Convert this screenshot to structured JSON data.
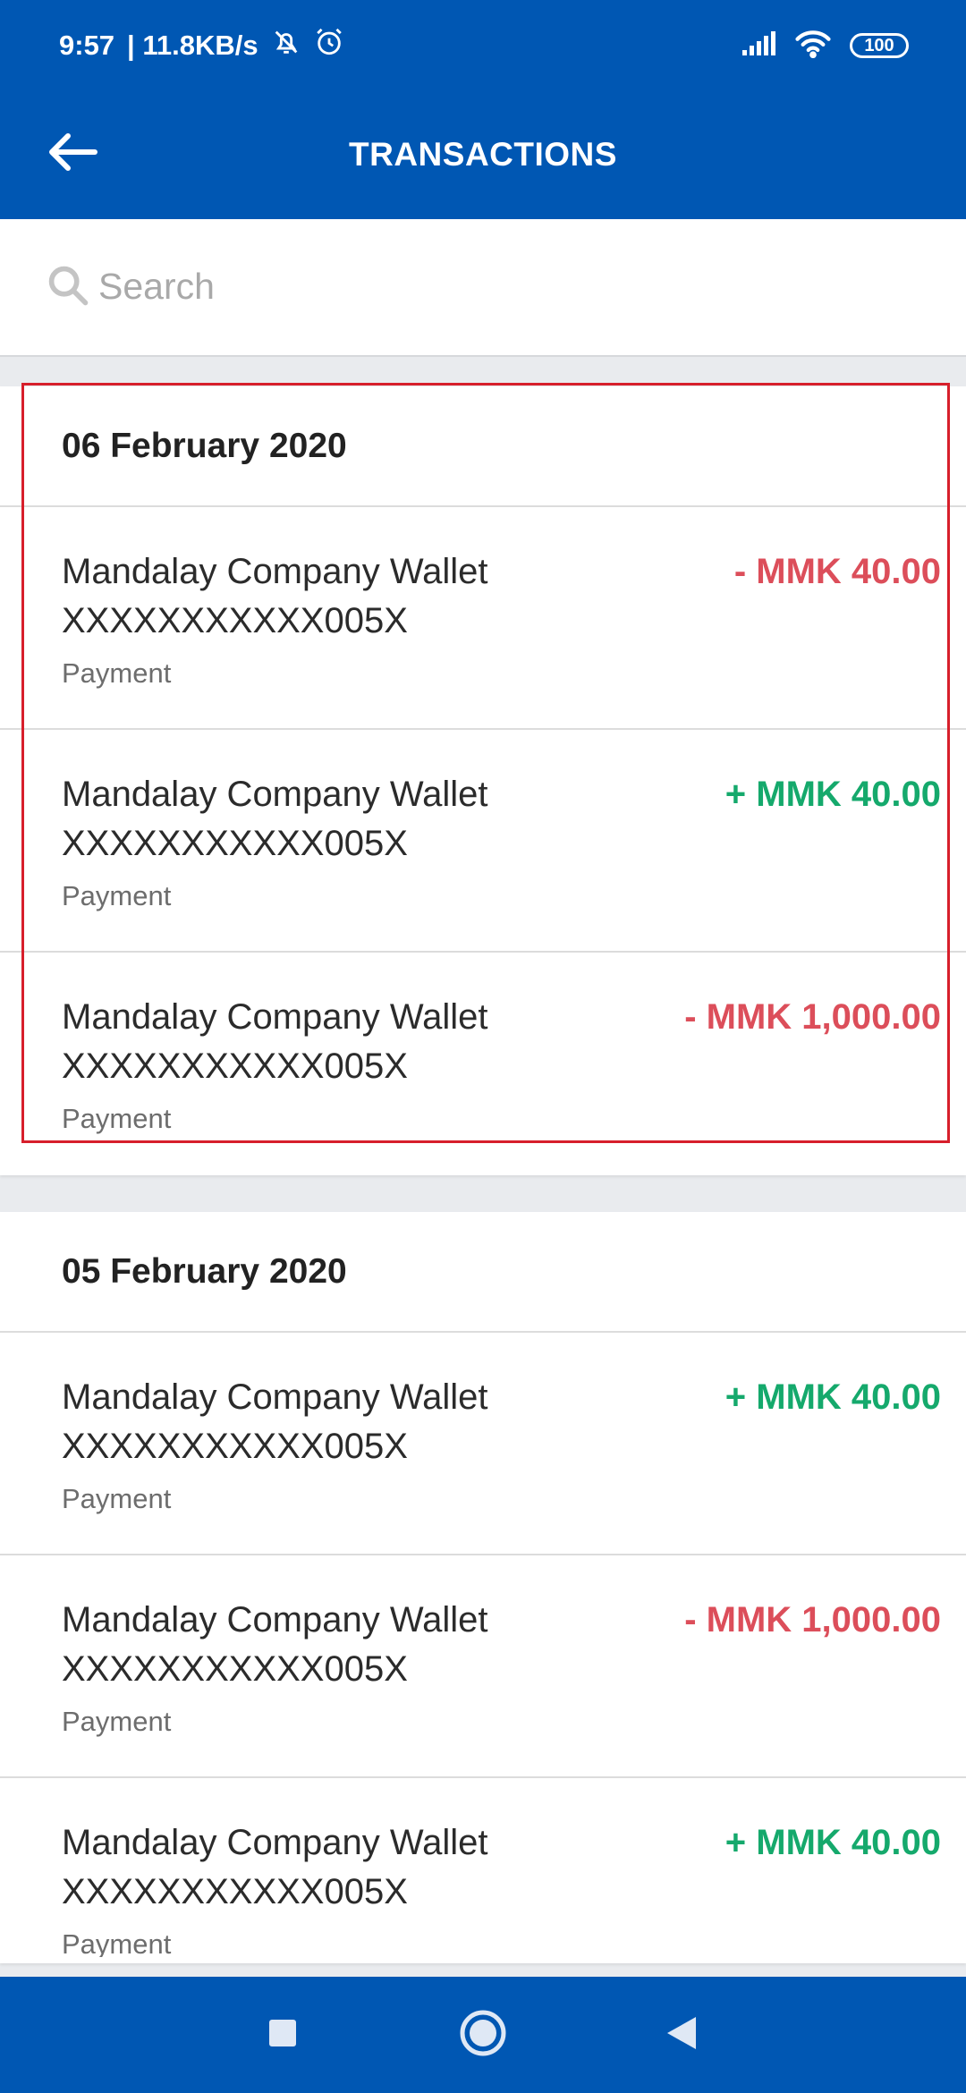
{
  "status_bar": {
    "time": "9:57",
    "speed": "| 11.8KB/s",
    "battery": "100",
    "icons": [
      "bell-off-icon",
      "alarm-icon",
      "signal-icon",
      "wifi-icon",
      "battery-icon"
    ]
  },
  "app_bar": {
    "title": "TRANSACTIONS",
    "back_icon": "arrow-left-icon"
  },
  "search": {
    "placeholder": "Search",
    "value": ""
  },
  "colors": {
    "primary": "#0057b3",
    "debit": "#dc4e5a",
    "credit": "#15a96c",
    "highlight": "#d71f2b"
  },
  "groups": [
    {
      "date": "06 February 2020",
      "transactions": [
        {
          "name": "Mandalay Company Wallet",
          "account": "XXXXXXXXXXX005X",
          "type": "Payment",
          "amount": "- MMK 40.00",
          "direction": "debit"
        },
        {
          "name": "Mandalay Company Wallet",
          "account": "XXXXXXXXXXX005X",
          "type": "Payment",
          "amount": "+ MMK 40.00",
          "direction": "credit"
        },
        {
          "name": "Mandalay Company Wallet",
          "account": "XXXXXXXXXXX005X",
          "type": "Payment",
          "amount": "- MMK 1,000.00",
          "direction": "debit"
        }
      ]
    },
    {
      "date": "05 February 2020",
      "transactions": [
        {
          "name": "Mandalay Company Wallet",
          "account": "XXXXXXXXXXX005X",
          "type": "Payment",
          "amount": "+ MMK 40.00",
          "direction": "credit"
        },
        {
          "name": "Mandalay Company Wallet",
          "account": "XXXXXXXXXXX005X",
          "type": "Payment",
          "amount": "- MMK 1,000.00",
          "direction": "debit"
        },
        {
          "name": "Mandalay Company Wallet",
          "account": "XXXXXXXXXXX005X",
          "type": "Payment",
          "amount": "+ MMK 40.00",
          "direction": "credit"
        }
      ]
    }
  ],
  "nav_bar": {
    "icons": [
      "recents-square-icon",
      "home-circle-icon",
      "back-triangle-icon"
    ]
  }
}
